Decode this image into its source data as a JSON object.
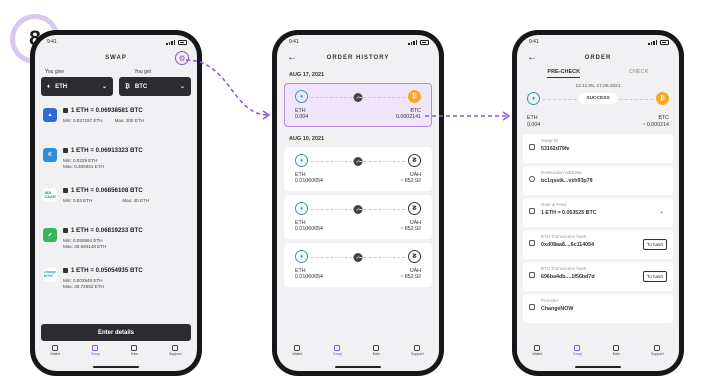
{
  "step_number": "8",
  "phone1": {
    "time": "9:41",
    "title": "SWAP",
    "give_label": "You give",
    "get_label": "You get",
    "give_value": "ETH",
    "get_value": "BTC",
    "offers": [
      {
        "rate": "1 ETH = 0.06938581 BTC",
        "min": "Min: 0.027157 ETH",
        "max": "Max: 200 ETH",
        "logo": "CL",
        "logo_color": "#2f6ad9"
      },
      {
        "rate": "1 ETH = 0.06913323 BTC",
        "min": "Min: 0.0229 ETH",
        "max": "Max: 0.306941 ETH",
        "logo": "K",
        "logo_color": "#2a8fd8"
      },
      {
        "rate": "1 ETH = 0.06856108 BTC",
        "min": "Min: 0.53 ETH",
        "max": "Max: 40 ETH",
        "logo": "365 CASH",
        "logo_color": "#1a9c54"
      },
      {
        "rate": "1 ETH = 0.06819233 BTC",
        "min": "Min: 0.050694 ETH",
        "max": "Max: 30.694148 ETH",
        "logo": "↗",
        "logo_color": "#3bb25c"
      },
      {
        "rate": "1 ETH = 0.05054935 BTC",
        "min": "Min: 0.003848 ETH",
        "max": "Max: 30.72593 ETH",
        "logo": "change NOW",
        "logo_color": "#2aa2a8"
      }
    ],
    "enter_label": "Enter details",
    "tabs": [
      "Wallet",
      "Swap",
      "Earn",
      "Support"
    ]
  },
  "phone2": {
    "time": "9:41",
    "title": "ORDER HISTORY",
    "dates": [
      "AUG 17, 2021",
      "AUG 10, 2021"
    ],
    "orders": [
      {
        "from": "ETH",
        "from_amt": "0.004",
        "to": "BTC",
        "to_amt": "0.0002141"
      },
      {
        "from": "ETH",
        "from_amt": "0.01060654",
        "to": "UAH",
        "to_amt": "~ 852.92"
      },
      {
        "from": "ETH",
        "from_amt": "0.01060654",
        "to": "UAH",
        "to_amt": "~ 852.92"
      },
      {
        "from": "ETH",
        "from_amt": "0.01060654",
        "to": "UAH",
        "to_amt": "~ 852.92"
      }
    ],
    "tabs": [
      "Wallet",
      "Swap",
      "Earn",
      "Support"
    ]
  },
  "phone3": {
    "time": "9:41",
    "title": "ORDER",
    "tab_precheck": "PRE-CHECK",
    "tab_check": "CHECK",
    "timestamp": "12:11:05, 17.08.2021",
    "status": "SUCCESS",
    "from": "ETH",
    "from_amt": "0.004",
    "to": "BTC",
    "to_amt": "~ 0.000214",
    "details": [
      {
        "label": "Swap ID",
        "value": "53162d79fe"
      },
      {
        "label": "Destination address",
        "value": "bc1qsstk...vxh93p78"
      },
      {
        "label": "Rate & Fees",
        "value": "1 ETH = 0.053525 BTC"
      },
      {
        "label": "ETH Transaction hash",
        "value": "0xd08aa8....6c114054"
      },
      {
        "label": "BTC Transaction hash",
        "value": "696ba4db....1f56bd7d"
      },
      {
        "label": "Provider",
        "value": "ChangeNOW"
      }
    ],
    "to_hash_label": "To hash",
    "tabs": [
      "Wallet",
      "Swap",
      "Earn",
      "Support"
    ]
  },
  "colors": {
    "accent": "#8a56d8",
    "selected_bg": "#efe6fb",
    "btc": "#f6a926",
    "eth": "#2aa2a8"
  }
}
